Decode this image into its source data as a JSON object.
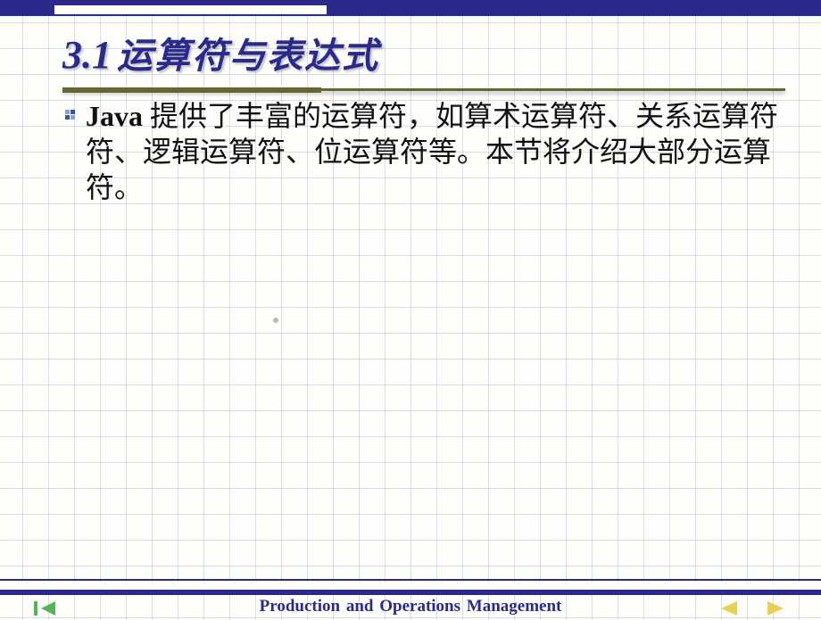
{
  "slide": {
    "heading_number": "3.1",
    "heading_text": "运算符与表达式",
    "body_java": "Java",
    "body_rest": " 提供了丰富的运算符，如算术运算符、关系运算符符、逻辑运算符、位运算符等。本节将介绍大部分运算符。"
  },
  "footer": {
    "text": "Production  and Operations  Management"
  },
  "nav": {
    "first": "first-slide",
    "prev": "previous-slide",
    "next": "next-slide"
  },
  "colors": {
    "accent": "#2a2a8a",
    "rule": "#656535"
  }
}
